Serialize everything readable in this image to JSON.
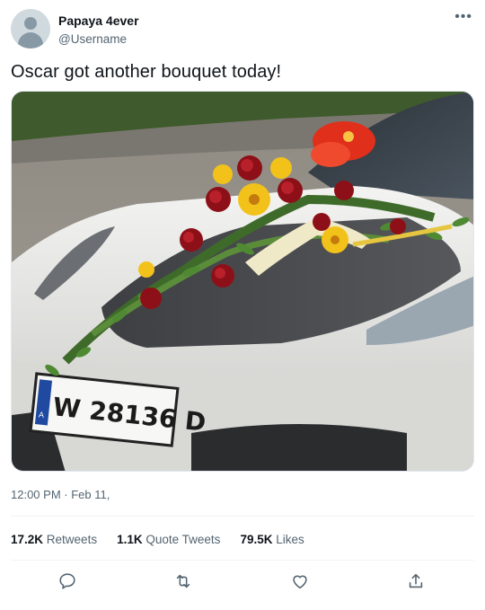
{
  "user": {
    "display_name": "Papaya 4ever",
    "handle": "@Username"
  },
  "tweet": {
    "text": "Oscar got another bouquet today!",
    "timestamp": "12:00 PM · Feb 11,",
    "media": {
      "plate_country": "A",
      "plate_text": "W 28136 D"
    }
  },
  "stats": {
    "retweets_count": "17.2K",
    "retweets_label": "Retweets",
    "quotes_count": "1.1K",
    "quotes_label": "Quote Tweets",
    "likes_count": "79.5K",
    "likes_label": "Likes"
  },
  "icons": {
    "more": "more-horizontal-icon",
    "reply": "reply-icon",
    "retweet": "retweet-icon",
    "like": "heart-icon",
    "share": "share-icon"
  },
  "colors": {
    "text_primary": "#0f1419",
    "text_secondary": "#536471",
    "divider": "#eff3f4"
  }
}
